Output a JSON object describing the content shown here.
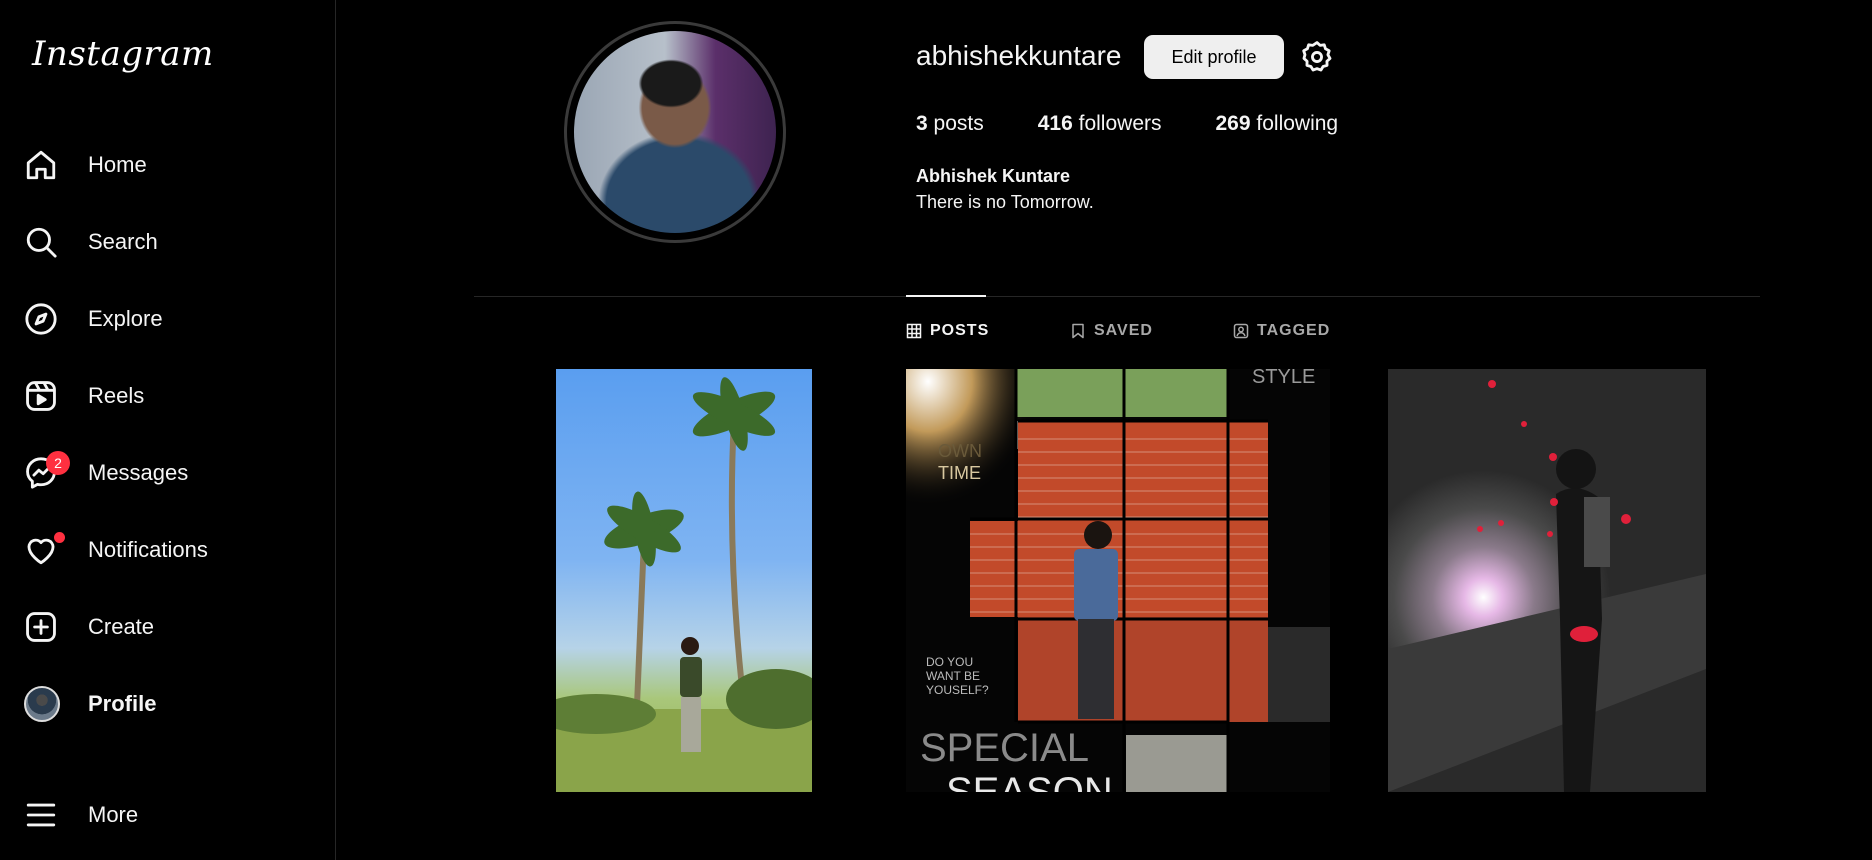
{
  "sidebar": {
    "logo": "Instagram",
    "items": [
      {
        "label": "Home",
        "icon": "home-icon"
      },
      {
        "label": "Search",
        "icon": "search-icon"
      },
      {
        "label": "Explore",
        "icon": "compass-icon"
      },
      {
        "label": "Reels",
        "icon": "reels-icon"
      },
      {
        "label": "Messages",
        "icon": "messenger-icon",
        "badge": "2"
      },
      {
        "label": "Notifications",
        "icon": "heart-icon"
      },
      {
        "label": "Create",
        "icon": "plus-square-icon"
      },
      {
        "label": "Profile",
        "icon": "avatar"
      },
      {
        "label": "More",
        "icon": "menu-icon"
      }
    ]
  },
  "profile": {
    "username": "abhishekkuntare",
    "edit_label": "Edit profile",
    "stats": {
      "posts_count": "3",
      "posts_label": "posts",
      "followers_count": "416",
      "followers_label": "followers",
      "following_count": "269",
      "following_label": "following"
    },
    "full_name": "Abhishek Kuntare",
    "bio": "There is no Tomorrow."
  },
  "tabs": {
    "posts": "POSTS",
    "saved": "SAVED",
    "tagged": "TAGGED"
  },
  "posts": {
    "p2_text1": "STYLE",
    "p2_text2": "OWN",
    "p2_text3": "TIME",
    "p2_text4": "DO YOU",
    "p2_text5": "WANT BE",
    "p2_text6": "YOUSELF?",
    "p2_text7": "SPECIAL",
    "p2_text8": "SEASON"
  }
}
